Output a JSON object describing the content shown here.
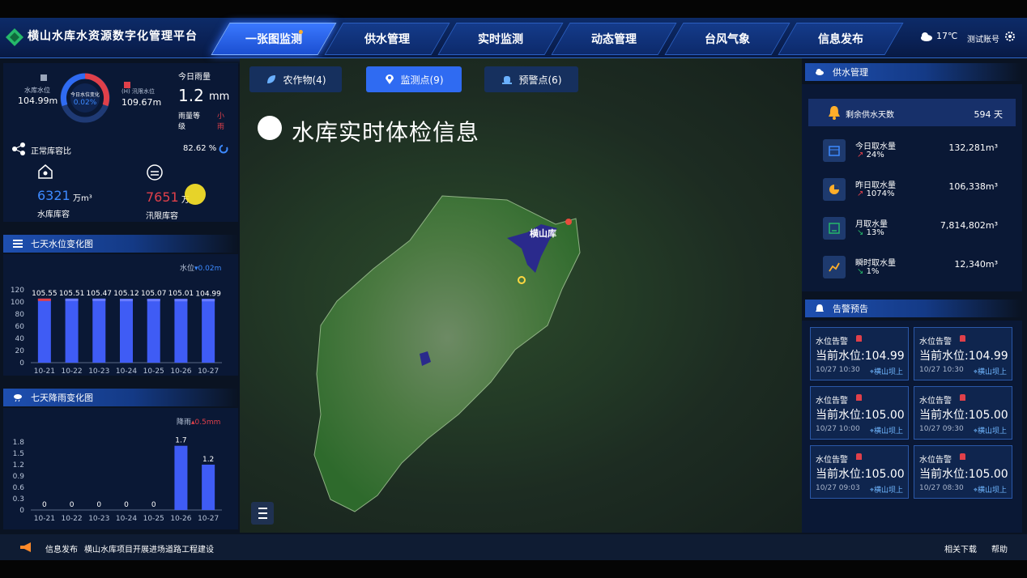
{
  "app_title": "横山水库水资源数字化管理平台",
  "nav": [
    "一张图监测",
    "供水管理",
    "实时监测",
    "动态管理",
    "台风气象",
    "信息发布"
  ],
  "header_right": {
    "temperature": "17℃",
    "account": "测试账号"
  },
  "map_tabs": [
    {
      "label": "农作物(4)"
    },
    {
      "label": "监测点(9)"
    },
    {
      "label": "预警点(6)"
    }
  ],
  "map_title": "水库实时体检信息",
  "map_label": "横山库",
  "reservoir": {
    "left_label": "水库水位",
    "left_value": "104.99m",
    "gauge_label": "今日水位变化",
    "gauge_value": "0.02%",
    "right_label": "(H) 汛限水位",
    "right_value": "109.67m",
    "rain_label": "今日雨量",
    "rain_value": "1.2",
    "rain_unit": "mm",
    "rain_level_label": "雨量等级",
    "rain_level_value": "小雨",
    "ratio_label": "正常库容比",
    "ratio_value": "82.62 %",
    "cap1_value": "6321",
    "cap1_unit": "万m³",
    "cap1_label": "水库库容",
    "cap2_value": "7651",
    "cap2_unit": "万",
    "cap2_label": "汛限库容"
  },
  "water_level_panel": {
    "title": "七天水位变化图",
    "legend": "水位",
    "change": "0.02m"
  },
  "rain_panel": {
    "title": "七天降雨变化图",
    "legend": "降雨",
    "change": "0.5mm"
  },
  "chart_data": [
    {
      "type": "bar",
      "categories": [
        "10-21",
        "10-22",
        "10-23",
        "10-24",
        "10-25",
        "10-26",
        "10-27"
      ],
      "values": [
        105.55,
        105.51,
        105.47,
        105.12,
        105.07,
        105.01,
        104.99
      ],
      "yticks": [
        0,
        20,
        40,
        60,
        80,
        100,
        120
      ],
      "ylim": [
        0,
        120
      ]
    },
    {
      "type": "bar",
      "categories": [
        "10-21",
        "10-22",
        "10-23",
        "10-24",
        "10-25",
        "10-26",
        "10-27"
      ],
      "values": [
        0,
        0,
        0,
        0,
        0,
        1.7,
        1.2
      ],
      "yticks": [
        "0",
        "0.3",
        "0.6",
        "0.9",
        "1.2",
        "1.5",
        "1.8"
      ],
      "ylim": [
        0,
        1.8
      ]
    }
  ],
  "supply": {
    "title": "供水管理",
    "days_label": "剩余供水天数",
    "days_value": "594 天",
    "rows": [
      {
        "label": "今日取水量",
        "pct": "24%",
        "value": "132,281m³"
      },
      {
        "label": "昨日取水量",
        "pct": "1074%",
        "value": "106,338m³"
      },
      {
        "label": "月取水量",
        "pct": "13%",
        "value": "7,814,802m³"
      },
      {
        "label": "瞬时取水量",
        "pct": "1%",
        "value": "12,340m³"
      }
    ]
  },
  "alarm": {
    "title": "告警预告",
    "items": [
      {
        "type": "水位告警",
        "main": "当前水位:104.99",
        "time": "10/27 10:30",
        "loc": "横山坝上"
      },
      {
        "type": "水位告警",
        "main": "当前水位:104.99",
        "time": "10/27 10:30",
        "loc": "横山坝上"
      },
      {
        "type": "水位告警",
        "main": "当前水位:105.00",
        "time": "10/27 10:00",
        "loc": "横山坝上"
      },
      {
        "type": "水位告警",
        "main": "当前水位:105.00",
        "time": "10/27 09:30",
        "loc": "横山坝上"
      },
      {
        "type": "水位告警",
        "main": "当前水位:105.00",
        "time": "10/27 09:03",
        "loc": "横山坝上"
      },
      {
        "type": "水位告警",
        "main": "当前水位:105.00",
        "time": "10/27 08:30",
        "loc": "横山坝上"
      }
    ]
  },
  "footer": {
    "label": "信息发布",
    "text": "横山水库项目开展进场道路工程建设",
    "download": "相关下载",
    "help": "帮助"
  }
}
